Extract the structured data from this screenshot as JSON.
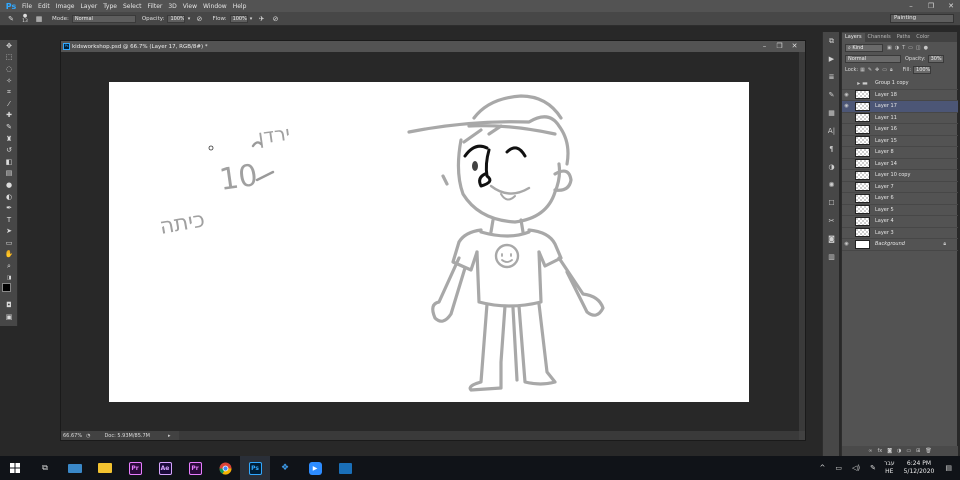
{
  "app": {
    "logo": "Ps"
  },
  "menu": [
    "File",
    "Edit",
    "Image",
    "Layer",
    "Type",
    "Select",
    "Filter",
    "3D",
    "View",
    "Window",
    "Help"
  ],
  "options": {
    "brush_size": "13",
    "mode_label": "Mode:",
    "mode_value": "Normal",
    "opacity_label": "Opacity:",
    "opacity_value": "100%",
    "flow_label": "Flow:",
    "flow_value": "100%",
    "workspace": "Painting"
  },
  "document": {
    "title": "kidsworkshop.psd @ 66.7% (Layer 17, RGB/8#) *",
    "zoom": "66.67%",
    "doc_info": "Doc: 5.93M/85.7M",
    "handwriting": [
      "ירדן",
      "10",
      "כיתה"
    ]
  },
  "layers_panel": {
    "tabs": [
      "Layers",
      "Channels",
      "Paths",
      "Color"
    ],
    "filter_kind": "Kind",
    "blend_mode": "Normal",
    "opacity_label": "Opacity:",
    "opacity_value": "30%",
    "lock_label": "Lock:",
    "fill_label": "Fill:",
    "fill_value": "100%",
    "layers": [
      {
        "name": "Group 1 copy",
        "type": "group",
        "visible": false,
        "selected": false
      },
      {
        "name": "Layer 18",
        "type": "layer",
        "visible": true,
        "selected": false
      },
      {
        "name": "Layer 17",
        "type": "layer",
        "visible": true,
        "selected": true
      },
      {
        "name": "Layer 11",
        "type": "layer",
        "visible": false,
        "selected": false
      },
      {
        "name": "Layer 16",
        "type": "layer",
        "visible": false,
        "selected": false
      },
      {
        "name": "Layer 15",
        "type": "layer",
        "visible": false,
        "selected": false
      },
      {
        "name": "Layer 8",
        "type": "layer",
        "visible": false,
        "selected": false
      },
      {
        "name": "Layer 14",
        "type": "layer",
        "visible": false,
        "selected": false
      },
      {
        "name": "Layer 10 copy",
        "type": "layer",
        "visible": false,
        "selected": false
      },
      {
        "name": "Layer 7",
        "type": "layer",
        "visible": false,
        "selected": false
      },
      {
        "name": "Layer 6",
        "type": "layer",
        "visible": false,
        "selected": false
      },
      {
        "name": "Layer 5",
        "type": "layer",
        "visible": false,
        "selected": false
      },
      {
        "name": "Layer 4",
        "type": "layer",
        "visible": false,
        "selected": false
      },
      {
        "name": "Layer 3",
        "type": "layer",
        "visible": false,
        "selected": false
      },
      {
        "name": "Background",
        "type": "background",
        "visible": true,
        "selected": false
      }
    ]
  },
  "taskbar": {
    "apps": [
      {
        "label": "Pr",
        "bg": "#2a0a3a",
        "fg": "#e77cff"
      },
      {
        "label": "Ae",
        "bg": "#1a0a3a",
        "fg": "#d6a3ff"
      },
      {
        "label": "Pr",
        "bg": "#2a0a3a",
        "fg": "#e77cff"
      },
      {
        "label": "Ps",
        "bg": "#001e36",
        "fg": "#31a8ff"
      }
    ],
    "lang_top": "עבר",
    "lang_bottom": "HE",
    "time": "6:24 PM",
    "date": "5/12/2020"
  },
  "colors": {
    "accent": "#31a8ff",
    "selected_layer": "#4c5676",
    "panel": "#535353"
  }
}
